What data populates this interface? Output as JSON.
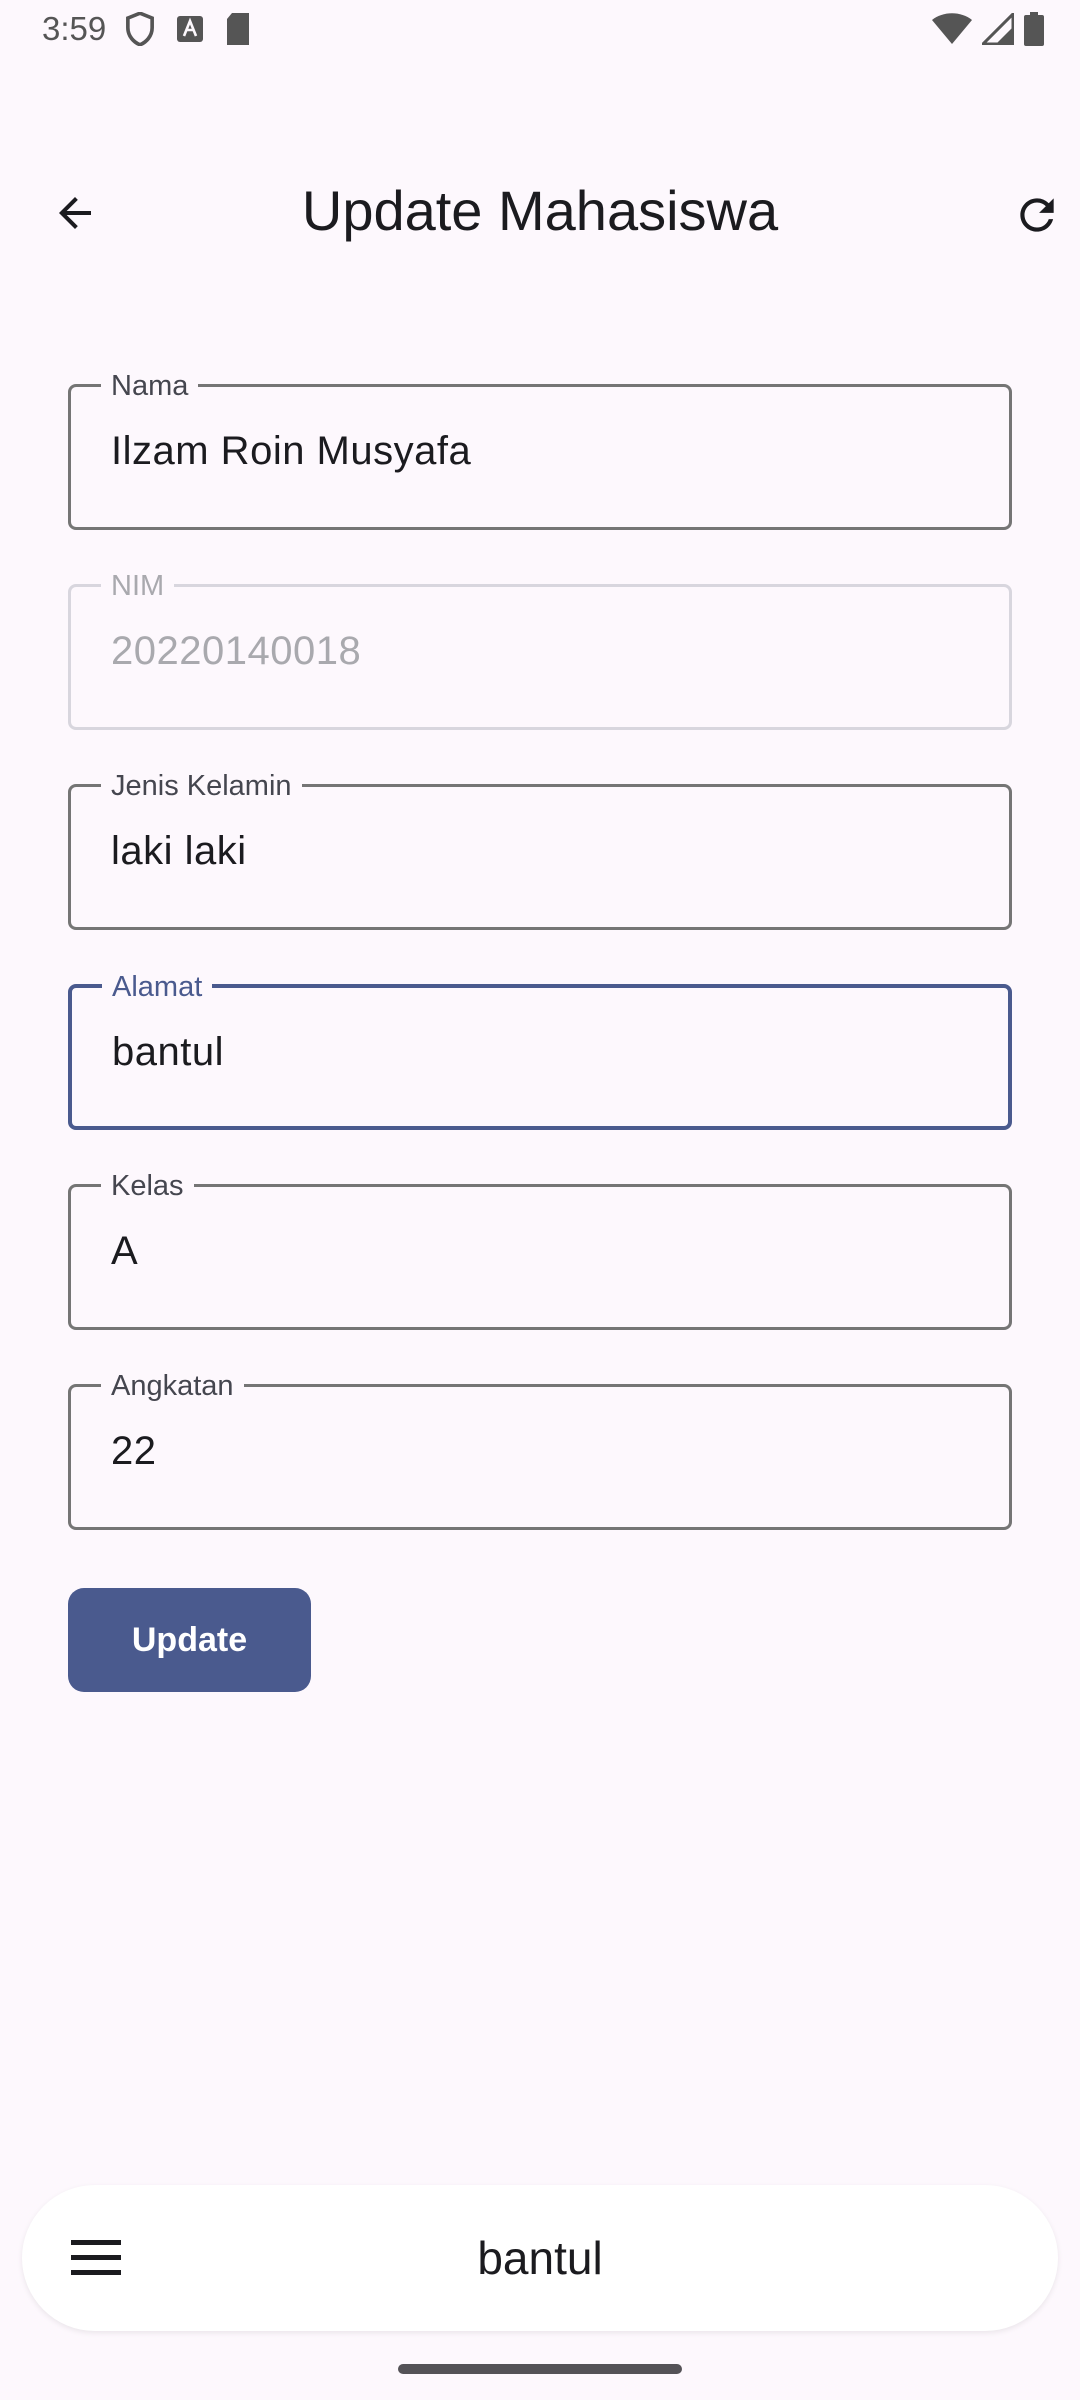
{
  "status_bar": {
    "time": "3:59"
  },
  "app_bar": {
    "title": "Update Mahasiswa"
  },
  "form": {
    "fields": [
      {
        "label": "Nama",
        "value": "Ilzam Roin Musyafa"
      },
      {
        "label": "NIM",
        "value": "20220140018"
      },
      {
        "label": "Jenis Kelamin",
        "value": "laki laki"
      },
      {
        "label": "Alamat",
        "value": "bantul"
      },
      {
        "label": "Kelas",
        "value": "A"
      },
      {
        "label": "Angkatan",
        "value": "22"
      }
    ],
    "submit_label": "Update"
  },
  "keyboard_bar": {
    "suggestion": "bantul"
  },
  "colors": {
    "accent": "#4a5a8e",
    "background": "#fdf8fd"
  }
}
